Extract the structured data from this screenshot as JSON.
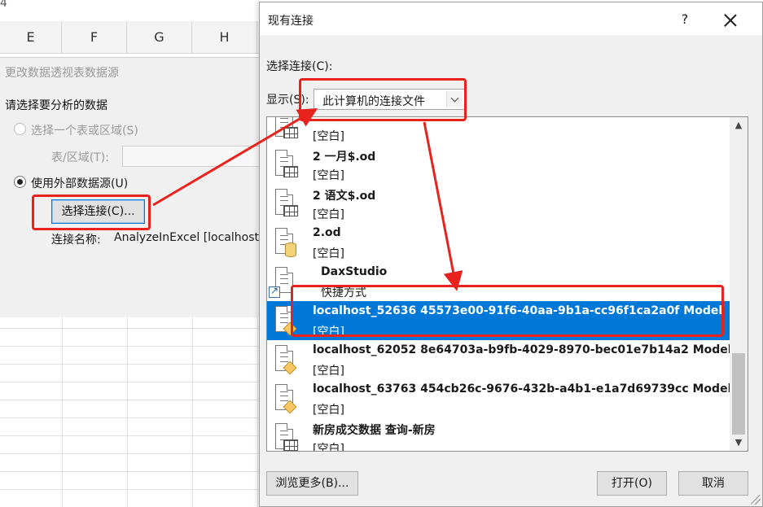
{
  "excel": {
    "corner_text": "4",
    "columns": [
      "E",
      "F",
      "G",
      "H"
    ]
  },
  "datasource_dialog": {
    "title": "更改数据透视表数据源",
    "section_label": "请选择要分析的数据",
    "option_range": "选择一个表或区域(S)",
    "range_label": "表/区域(T):",
    "option_external": "使用外部数据源(U)",
    "choose_button": "选择连接(C)...",
    "connection_name_label": "连接名称:",
    "connection_name_value": "AnalyzeInExcel [localhost"
  },
  "existing_connections": {
    "title": "现有连接",
    "help": "?",
    "choose_label": "选择连接(C):",
    "show_label": "显示(S):",
    "show_value": "此计算机的连接文件",
    "items": [
      {
        "name": "",
        "desc": "[空白]",
        "icon": "table-file-icon"
      },
      {
        "name": "2 一月$.od",
        "desc": "[空白]",
        "icon": "table-file-icon"
      },
      {
        "name": "2 语文$.od",
        "desc": "[空白]",
        "icon": "table-file-icon"
      },
      {
        "name": "2.od",
        "desc": "[空白]",
        "icon": "database-file-icon"
      },
      {
        "name": "DaxStudio",
        "desc": "快捷方式",
        "icon": "shortcut-icon"
      },
      {
        "name": "localhost_52636 45573e00-91f6-40aa-9b1a-cc96f1ca2a0f Model",
        "desc": "[空白]",
        "icon": "cube-file-icon",
        "selected": true
      },
      {
        "name": "localhost_62052 8e64703a-b9fb-4029-8970-bec01e7b14a2 Model",
        "desc": "[空白]",
        "icon": "cube-file-icon"
      },
      {
        "name": "localhost_63763 454cb26c-9676-432b-a4b1-e1a7d69739cc Model",
        "desc": "[空白]",
        "icon": "cube-file-icon"
      },
      {
        "name": "新房成交数据 查询-新房",
        "desc": "[空白]",
        "icon": "table-file-icon"
      }
    ],
    "browse_button": "浏览更多(B)...",
    "open_button": "打开(O)",
    "cancel_button": "取消"
  },
  "colors": {
    "selection": "#0078d7",
    "annotation": "#e8231e"
  }
}
